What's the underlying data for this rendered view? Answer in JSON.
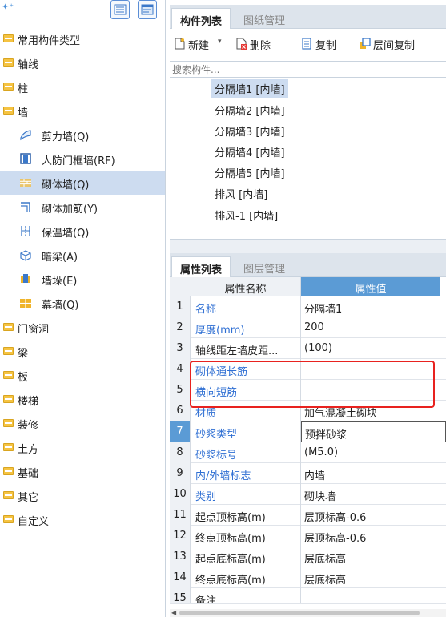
{
  "left_tree": {
    "categories": [
      {
        "label": "常用构件类型",
        "icon": "folder-icon"
      },
      {
        "label": "轴线",
        "icon": "folder-icon"
      },
      {
        "label": "柱",
        "icon": "folder-icon"
      },
      {
        "label": "墙",
        "icon": "folder-open-icon"
      }
    ],
    "wall_children": [
      {
        "label": "剪力墙(Q)",
        "icon": "shear-wall-icon"
      },
      {
        "label": "人防门框墙(RF)",
        "icon": "civil-defense-door-frame-icon"
      },
      {
        "label": "砌体墙(Q)",
        "icon": "masonry-wall-icon",
        "selected": true
      },
      {
        "label": "砌体加筋(Y)",
        "icon": "masonry-rebar-icon"
      },
      {
        "label": "保温墙(Q)",
        "icon": "insulation-wall-icon"
      },
      {
        "label": "暗梁(A)",
        "icon": "hidden-beam-icon"
      },
      {
        "label": "墙垛(E)",
        "icon": "wall-pier-icon"
      },
      {
        "label": "幕墙(Q)",
        "icon": "curtain-wall-icon"
      }
    ],
    "more_categories": [
      {
        "label": "门窗洞"
      },
      {
        "label": "梁"
      },
      {
        "label": "板"
      },
      {
        "label": "楼梯"
      },
      {
        "label": "装修"
      },
      {
        "label": "土方"
      },
      {
        "label": "基础"
      },
      {
        "label": "其它"
      },
      {
        "label": "自定义"
      }
    ]
  },
  "component_panel": {
    "tabs": [
      "构件列表",
      "图纸管理"
    ],
    "toolbar": {
      "new_label": "新建",
      "delete_label": "删除",
      "copy_label": "复制",
      "floor_copy_label": "层间复制"
    },
    "search_placeholder": "搜索构件...",
    "items": [
      {
        "label": "分隔墙1 [内墙]",
        "selected": true
      },
      {
        "label": "分隔墙2 [内墙]"
      },
      {
        "label": "分隔墙3 [内墙]"
      },
      {
        "label": "分隔墙4 [内墙]"
      },
      {
        "label": "分隔墙5 [内墙]"
      },
      {
        "label": "排风 [内墙]"
      },
      {
        "label": "排风-1 [内墙]"
      }
    ]
  },
  "property_panel": {
    "tabs": [
      "属性列表",
      "图层管理"
    ],
    "headers": {
      "name": "属性名称",
      "value": "属性值"
    },
    "rows": [
      {
        "num": "1",
        "name": "名称",
        "value": "分隔墙1",
        "blue": true
      },
      {
        "num": "2",
        "name": "厚度(mm)",
        "value": "200",
        "blue": true
      },
      {
        "num": "3",
        "name": "轴线距左墙皮距...",
        "value": "(100)",
        "blue": false
      },
      {
        "num": "4",
        "name": "砌体通长筋",
        "value": "",
        "blue": true
      },
      {
        "num": "5",
        "name": "横向短筋",
        "value": "",
        "blue": true
      },
      {
        "num": "6",
        "name": "材质",
        "value": "加气混凝土砌块",
        "blue": true
      },
      {
        "num": "7",
        "name": "砂浆类型",
        "value": "预拌砂浆",
        "blue": true,
        "selected": true
      },
      {
        "num": "8",
        "name": "砂浆标号",
        "value": "(M5.0)",
        "blue": true
      },
      {
        "num": "9",
        "name": "内/外墙标志",
        "value": "内墙",
        "blue": true
      },
      {
        "num": "10",
        "name": "类别",
        "value": "砌块墙",
        "blue": true
      },
      {
        "num": "11",
        "name": "起点顶标高(m)",
        "value": "层顶标高-0.6",
        "blue": false
      },
      {
        "num": "12",
        "name": "终点顶标高(m)",
        "value": "层顶标高-0.6",
        "blue": false
      },
      {
        "num": "13",
        "name": "起点底标高(m)",
        "value": "层底标高",
        "blue": false
      },
      {
        "num": "14",
        "name": "终点底标高(m)",
        "value": "层底标高",
        "blue": false
      },
      {
        "num": "15",
        "name": "备注",
        "value": "",
        "blue": false
      }
    ]
  },
  "colors": {
    "selection": "#cddcf0",
    "header_accent": "#5b9bd5",
    "link_blue": "#2f6fd3",
    "highlight_box": "#e8221f",
    "folder": "#f5c342"
  }
}
